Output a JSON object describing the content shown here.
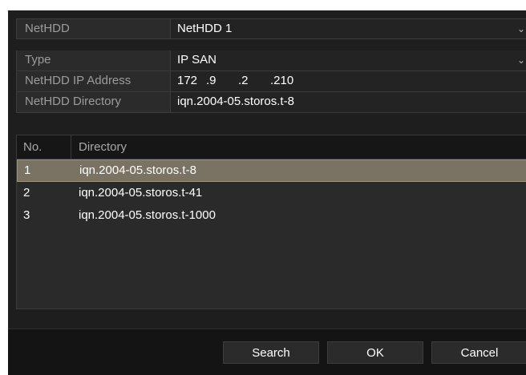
{
  "netHDD": {
    "label": "NetHDD",
    "value": "NetHDD 1"
  },
  "type": {
    "label": "Type",
    "value": "IP SAN"
  },
  "ipAddress": {
    "label": "NetHDD IP Address",
    "octets": [
      "172",
      ".9",
      ".2",
      ".210"
    ]
  },
  "directory": {
    "label": "NetHDD Directory",
    "value": "iqn.2004-05.storos.t-8"
  },
  "table": {
    "columns": [
      "No.",
      "Directory"
    ],
    "rows": [
      {
        "no": "1",
        "directory": "iqn.2004-05.storos.t-8",
        "selected": true
      },
      {
        "no": "2",
        "directory": "iqn.2004-05.storos.t-41",
        "selected": false
      },
      {
        "no": "3",
        "directory": "iqn.2004-05.storos.t-1000",
        "selected": false
      }
    ]
  },
  "buttons": {
    "search": "Search",
    "ok": "OK",
    "cancel": "Cancel"
  },
  "icons": {
    "dropdown": "chevron-down-icon"
  },
  "colors": {
    "selectedRow": "#7a7262",
    "background": "#1e1e1e"
  }
}
